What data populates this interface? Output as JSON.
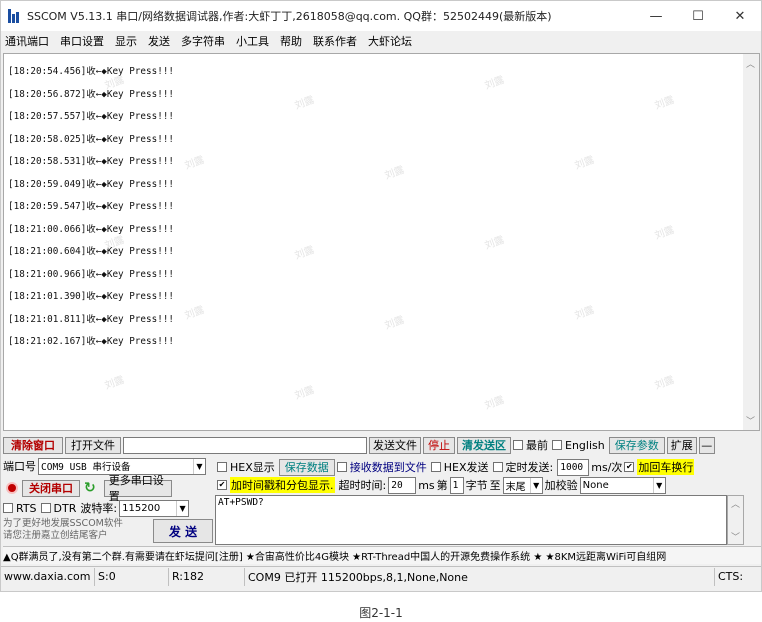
{
  "window": {
    "title": "SSCOM V5.13.1 串口/网络数据调试器,作者:大虾丁丁,2618058@qq.com. QQ群：52502449(最新版本)",
    "controls": [
      "—",
      "☐",
      "✕"
    ]
  },
  "menu": [
    "通讯端口",
    "串口设置",
    "显示",
    "发送",
    "多字符串",
    "小工具",
    "帮助",
    "联系作者",
    "大虾论坛"
  ],
  "receive": {
    "lines": [
      "[18:20:54.456]收←◆Key Press!!!",
      "[18:20:56.872]收←◆Key Press!!!",
      "[18:20:57.557]收←◆Key Press!!!",
      "[18:20:58.025]收←◆Key Press!!!",
      "[18:20:58.531]收←◆Key Press!!!",
      "[18:20:59.049]收←◆Key Press!!!",
      "[18:20:59.547]收←◆Key Press!!!",
      "[18:21:00.066]收←◆Key Press!!!",
      "[18:21:00.604]收←◆Key Press!!!",
      "[18:21:00.966]收←◆Key Press!!!",
      "[18:21:01.390]收←◆Key Press!!!",
      "[18:21:01.811]收←◆Key Press!!!",
      "[18:21:02.167]收←◆Key Press!!!"
    ],
    "watermark": "刘露"
  },
  "toolbar1": {
    "clear_btn": "清除窗口",
    "open_file_btn": "打开文件",
    "file_path": "",
    "send_file_btn": "发送文件",
    "stop_btn": "停止",
    "clear_send_btn": "清发送区",
    "front_label": "最前",
    "english_label": "English",
    "save_params_btn": "保存参数",
    "expand_btn": "扩展",
    "collapse_btn": "—"
  },
  "row2": {
    "port_label": "端口号",
    "port_value": "COM9 USB 串行设备",
    "hex_display": "HEX显示",
    "save_data_btn": "保存数据",
    "recv_to_file": "接收数据到文件",
    "hex_send": "HEX发送",
    "timed_send": "定时发送:",
    "interval": "1000",
    "interval_unit": "ms/次",
    "add_crlf": "加回车换行"
  },
  "row3": {
    "close_port_btn": "关闭串口",
    "more_ports_btn": "更多串口设置",
    "timestamp_label": "加时间戳和分包显示.",
    "timeout_label": "超时时间:",
    "timeout_value": "20",
    "timeout_unit": "ms",
    "byte_label": "第",
    "byte_value": "1",
    "byte_unit": "字节",
    "to_label": "至",
    "to_value": "末尾",
    "checksum_label": "加校验",
    "checksum_value": "None"
  },
  "row4": {
    "rts": "RTS",
    "dtr": "DTR",
    "baud_label": "波特率:",
    "baud_value": "115200"
  },
  "left": {
    "promo1": "为了更好地发展SSCOM软件",
    "promo2": "请您注册嘉立创结尾客户",
    "send_btn": "发 送"
  },
  "send_text": "AT+PSWD?",
  "adbar": "▲Q群满员了,没有第二个群.有需要请在虾坛提问[注册] ★合宙高性价比4G模块 ★RT-Thread中国人的开源免费操作系统 ★ ★8KM远距离WiFi可自组网",
  "status": {
    "site": "www.daxia.com",
    "s": "S:0",
    "r": "R:182",
    "port": "COM9 已打开  115200bps,8,1,None,None",
    "cts": "CTS:"
  },
  "caption": "图2-1-1",
  "colors": {
    "accent_red": "#b40000",
    "highlight": "#ffff00",
    "teal": "#008080"
  }
}
